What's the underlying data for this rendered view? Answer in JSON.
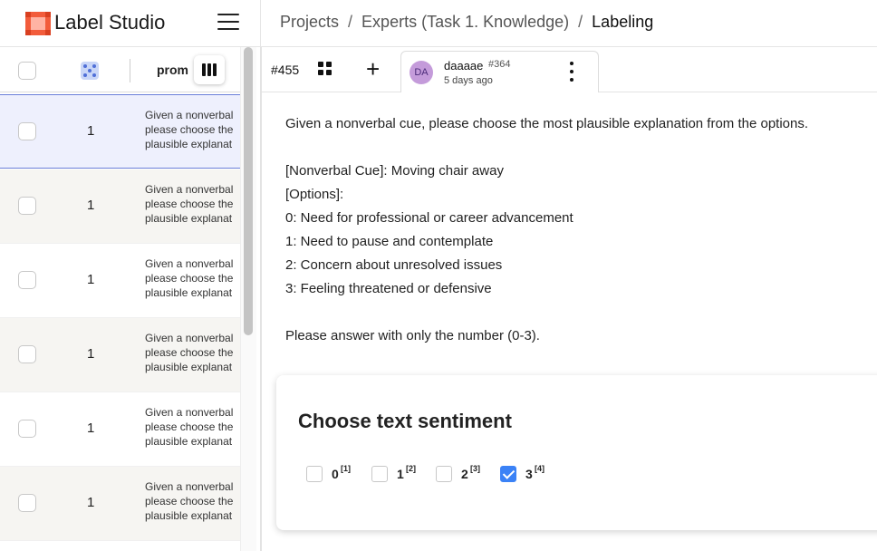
{
  "app": {
    "name": "Label Studio"
  },
  "breadcrumb": {
    "project": "Projects",
    "separator": "/",
    "subproject": "Experts (Task 1. Knowledge)",
    "current": "Labeling"
  },
  "table": {
    "header_prompt": "prom",
    "rows": [
      {
        "value": "1",
        "lines": [
          "Given a nonverbal",
          "please choose the",
          "plausible explanat"
        ],
        "selected": true
      },
      {
        "value": "1",
        "lines": [
          "Given a nonverbal",
          "please choose the",
          "plausible explanat"
        ]
      },
      {
        "value": "1",
        "lines": [
          "Given a nonverbal",
          "please choose the",
          "plausible explanat"
        ]
      },
      {
        "value": "1",
        "lines": [
          "Given a nonverbal",
          "please choose the",
          "plausible explanat"
        ]
      },
      {
        "value": "1",
        "lines": [
          "Given a nonverbal",
          "please choose the",
          "plausible explanat"
        ]
      },
      {
        "value": "1",
        "lines": [
          "Given a nonverbal",
          "please choose the",
          "plausible explanat"
        ]
      }
    ]
  },
  "annotation": {
    "task_id": "#455",
    "avatar_initials": "DA",
    "user": "daaaae",
    "annotation_id": "#364",
    "time": "5 days ago"
  },
  "prompt": {
    "intro": "Given a nonverbal cue, please choose the most plausible explanation from the options.",
    "cue": "[Nonverbal Cue]: Moving chair away",
    "options_label": "[Options]:",
    "options": [
      "0: Need for professional or career advancement",
      "1: Need to pause and contemplate",
      "2: Concern about unresolved issues",
      "3: Feeling threatened or defensive"
    ],
    "instruction": "Please answer with only the number (0-3)."
  },
  "choices": {
    "title": "Choose text sentiment",
    "items": [
      {
        "label": "0",
        "hotkey": "[1]",
        "checked": false
      },
      {
        "label": "1",
        "hotkey": "[2]",
        "checked": false
      },
      {
        "label": "2",
        "hotkey": "[3]",
        "checked": false
      },
      {
        "label": "3",
        "hotkey": "[4]",
        "checked": true
      }
    ]
  },
  "colors": {
    "accent": "#3b82f6",
    "logo": "#f25c3b",
    "avatar": "#c49bda",
    "selected_row": "#eef0fd"
  }
}
